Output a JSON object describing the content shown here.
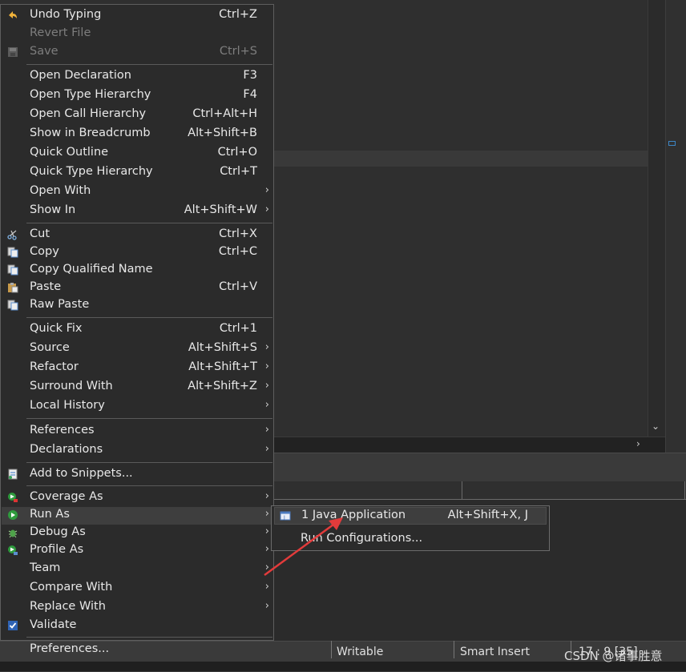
{
  "menu": {
    "items": [
      {
        "label": "Undo Typing",
        "shortcut": "Ctrl+Z",
        "icon": "undo-icon"
      },
      {
        "label": "Revert File",
        "shortcut": "",
        "disabled": true
      },
      {
        "label": "Save",
        "shortcut": "Ctrl+S",
        "disabled": true,
        "icon": "save-icon"
      },
      {
        "label": "Open Declaration",
        "shortcut": "F3"
      },
      {
        "label": "Open Type Hierarchy",
        "shortcut": "F4"
      },
      {
        "label": "Open Call Hierarchy",
        "shortcut": "Ctrl+Alt+H"
      },
      {
        "label": "Show in Breadcrumb",
        "shortcut": "Alt+Shift+B"
      },
      {
        "label": "Quick Outline",
        "shortcut": "Ctrl+O"
      },
      {
        "label": "Quick Type Hierarchy",
        "shortcut": "Ctrl+T"
      },
      {
        "label": "Open With",
        "shortcut": "",
        "submenu": true
      },
      {
        "label": "Show In",
        "shortcut": "Alt+Shift+W",
        "submenu": true
      },
      {
        "label": "Cut",
        "shortcut": "Ctrl+X",
        "icon": "scissors-icon"
      },
      {
        "label": "Copy",
        "shortcut": "Ctrl+C",
        "icon": "copy-icon"
      },
      {
        "label": "Copy Qualified Name",
        "shortcut": "",
        "icon": "copy-qualified-icon"
      },
      {
        "label": "Paste",
        "shortcut": "Ctrl+V",
        "icon": "paste-icon"
      },
      {
        "label": "Raw Paste",
        "shortcut": "",
        "icon": "raw-paste-icon"
      },
      {
        "label": "Quick Fix",
        "shortcut": "Ctrl+1"
      },
      {
        "label": "Source",
        "shortcut": "Alt+Shift+S",
        "submenu": true
      },
      {
        "label": "Refactor",
        "shortcut": "Alt+Shift+T",
        "submenu": true
      },
      {
        "label": "Surround With",
        "shortcut": "Alt+Shift+Z",
        "submenu": true
      },
      {
        "label": "Local History",
        "shortcut": "",
        "submenu": true
      },
      {
        "label": "References",
        "shortcut": "",
        "submenu": true
      },
      {
        "label": "Declarations",
        "shortcut": "",
        "submenu": true
      },
      {
        "label": "Add to Snippets...",
        "shortcut": "",
        "icon": "snippets-icon"
      },
      {
        "label": "Coverage As",
        "shortcut": "",
        "submenu": true,
        "icon": "coverage-icon"
      },
      {
        "label": "Run As",
        "shortcut": "",
        "submenu": true,
        "icon": "run-icon",
        "hover": true
      },
      {
        "label": "Debug As",
        "shortcut": "",
        "submenu": true,
        "icon": "debug-bug-icon"
      },
      {
        "label": "Profile As",
        "shortcut": "",
        "submenu": true,
        "icon": "profile-icon"
      },
      {
        "label": "Team",
        "shortcut": "",
        "submenu": true
      },
      {
        "label": "Compare With",
        "shortcut": "",
        "submenu": true
      },
      {
        "label": "Replace With",
        "shortcut": "",
        "submenu": true
      },
      {
        "label": "Validate",
        "shortcut": "",
        "icon": "checkbox-icon"
      },
      {
        "label": "Preferences...",
        "shortcut": ""
      }
    ]
  },
  "submenu": {
    "items": [
      {
        "label": "1 Java Application",
        "shortcut": "Alt+Shift+X, J",
        "icon": "java-app-icon"
      },
      {
        "label": "Run Configurations...",
        "shortcut": ""
      }
    ]
  },
  "status": {
    "writable": "Writable",
    "insert_mode": "Smart Insert",
    "position": "17 : 9 [35]"
  },
  "watermark": "CSDN @诸事胜意",
  "colors": {
    "menu_bg": "#2b2b2b",
    "hover_bg": "#3e3e3e",
    "text": "#e8e8e8",
    "disabled_text": "#7d7d7d",
    "annotation_arrow": "#e23b3b"
  }
}
